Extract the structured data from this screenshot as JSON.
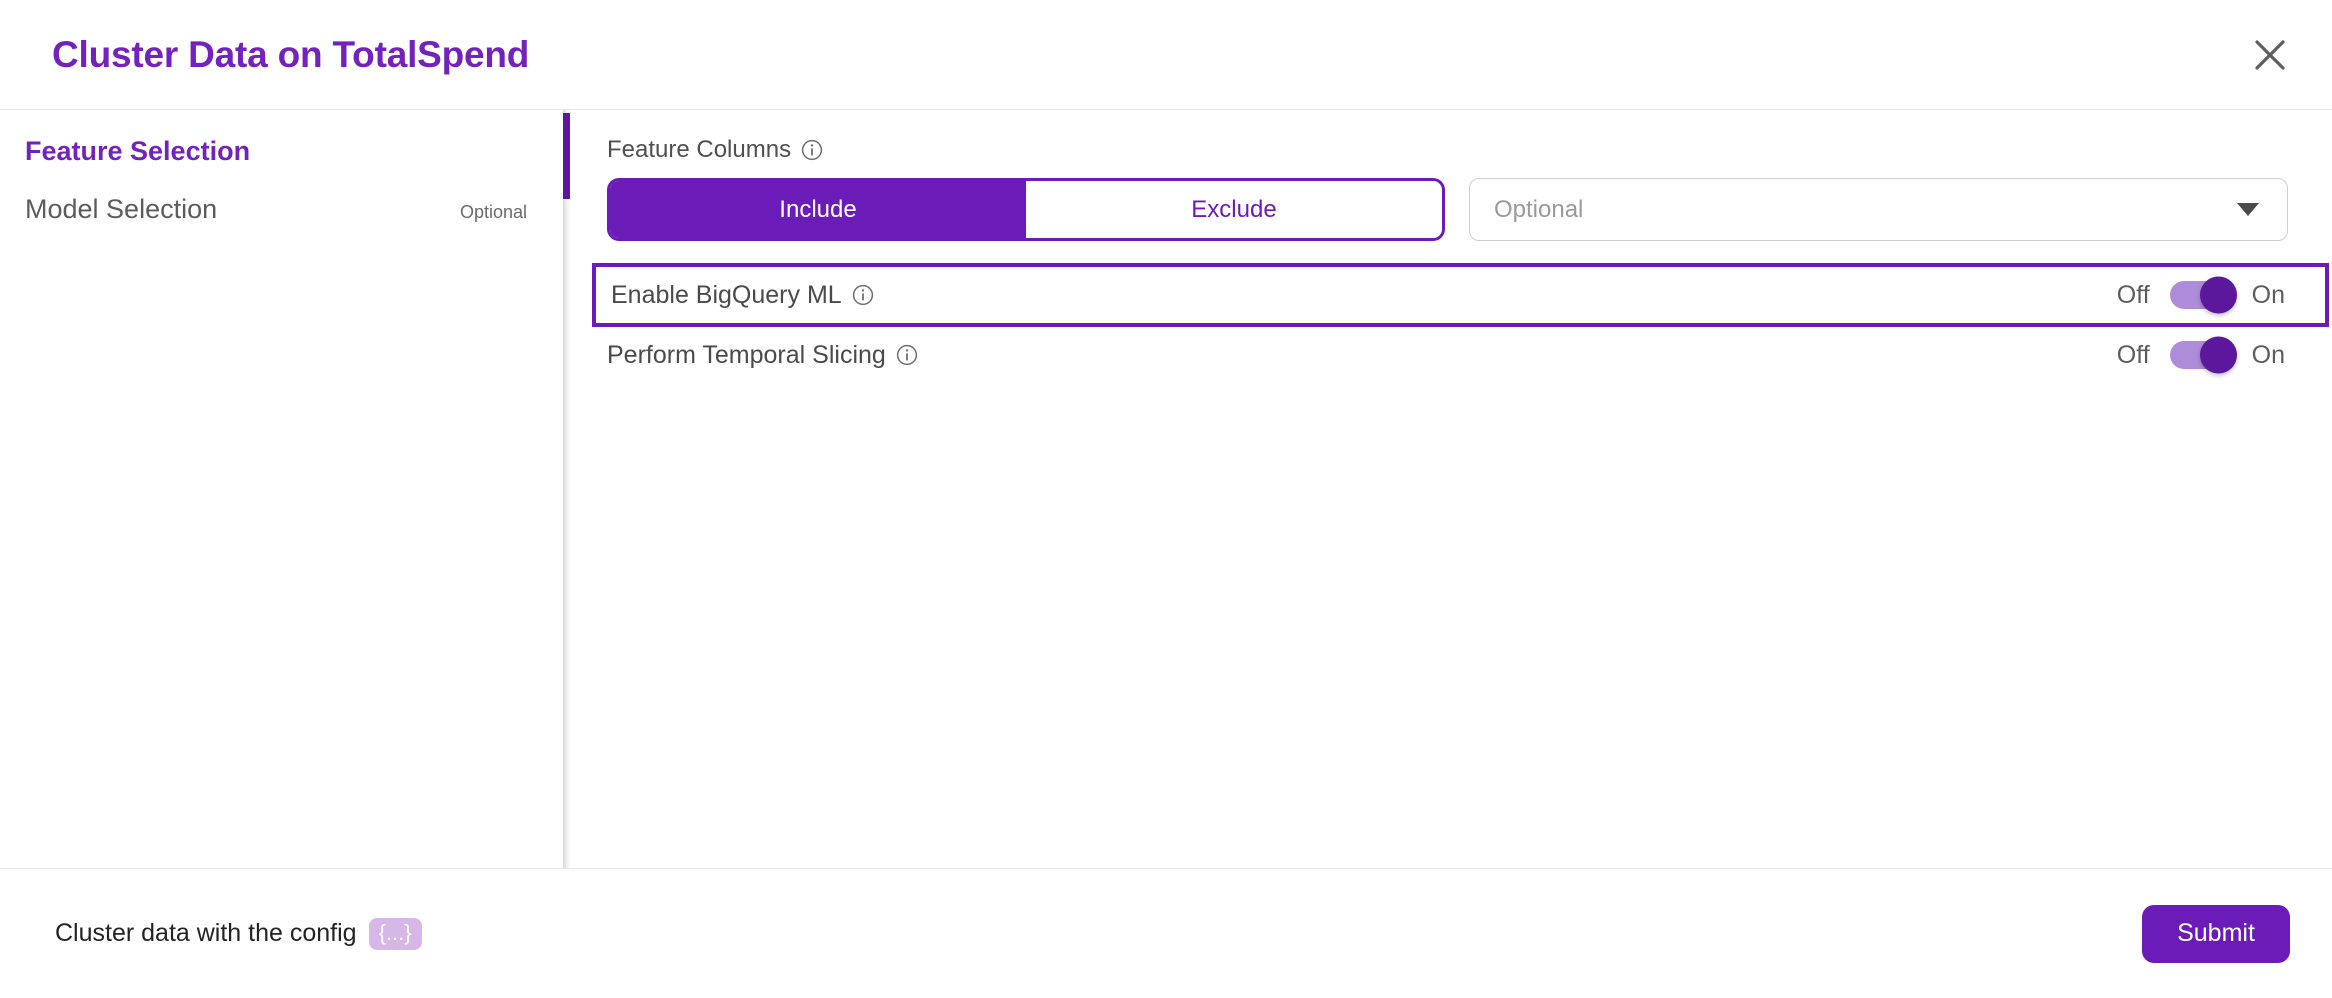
{
  "header": {
    "title": "Cluster Data on TotalSpend",
    "close_icon": "close-icon"
  },
  "sidebar": {
    "steps": [
      {
        "label": "Feature Selection",
        "badge": "",
        "active": true
      },
      {
        "label": "Model Selection",
        "badge": "Optional",
        "active": false
      }
    ]
  },
  "main": {
    "feature_columns": {
      "label": "Feature Columns",
      "info_icon": "info-icon",
      "segmented": {
        "include_label": "Include",
        "exclude_label": "Exclude",
        "selected": "Include"
      },
      "dropdown": {
        "placeholder": "Optional",
        "value": "Optional",
        "caret_icon": "chevron-down-icon"
      }
    },
    "toggles": [
      {
        "label": "Enable BigQuery ML",
        "info_icon": "info-icon",
        "off_label": "Off",
        "on_label": "On",
        "state": "On",
        "highlighted": true
      },
      {
        "label": "Perform Temporal Slicing",
        "info_icon": "info-icon",
        "off_label": "Off",
        "on_label": "On",
        "state": "On",
        "highlighted": false
      }
    ]
  },
  "footer": {
    "description": "Cluster data with the config",
    "config_badge": "{...}",
    "submit_label": "Submit"
  },
  "colors": {
    "brand_purple": "#6B1CB8",
    "title_purple": "#7322BE",
    "knob_purple": "#5B189C",
    "track_purple": "#AF8CD9",
    "badge_purple": "#D6B7E8"
  }
}
